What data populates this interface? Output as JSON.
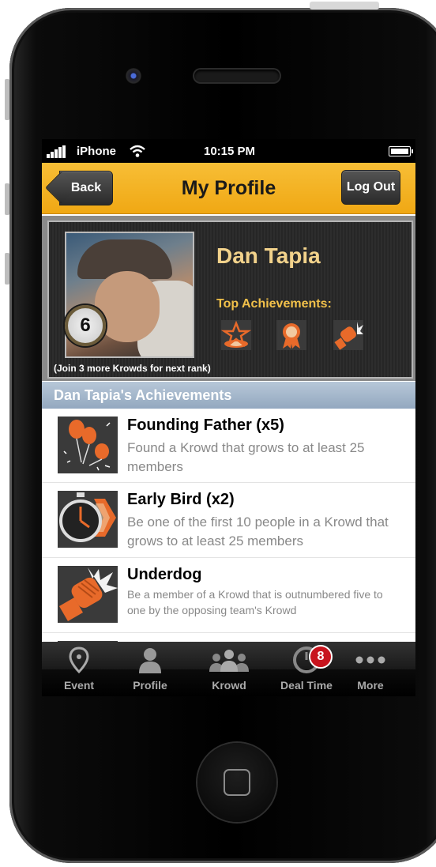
{
  "status_bar": {
    "carrier": "iPhone",
    "time": "10:15 PM"
  },
  "nav": {
    "back_label": "Back",
    "title": "My Profile",
    "logout_label": "Log Out"
  },
  "profile": {
    "name": "Dan Tapia",
    "rank": "6",
    "rank_note": "(Join 3 more Krowds for next rank)",
    "top_achievements_label": "Top Achievements:",
    "top_achievement_icons": [
      "star-target-icon",
      "ribbon-medal-icon",
      "fist-burst-icon"
    ]
  },
  "achievements": {
    "header": "Dan Tapia's Achievements",
    "items": [
      {
        "title": "Founding Father (x5)",
        "desc": "Found a Krowd that grows to at least 25 members",
        "icon": "balloons-icon"
      },
      {
        "title": "Early Bird (x2)",
        "desc": "Be one of the first 10 people in a Krowd that grows to at least 25 members",
        "icon": "stopwatch-icon"
      },
      {
        "title": "Underdog",
        "desc": "Be a member of a Krowd that is outnumbered five to one by the opposing team's Krowd",
        "icon": "fist-icon"
      }
    ]
  },
  "tabs": [
    {
      "label": "Event",
      "icon": "map-pin-icon"
    },
    {
      "label": "Profile",
      "icon": "person-icon"
    },
    {
      "label": "Krowd",
      "icon": "group-icon"
    },
    {
      "label": "Deal Time",
      "icon": "timer-icon",
      "badge": "8"
    },
    {
      "label": "More",
      "icon": "more-dots-icon"
    }
  ],
  "colors": {
    "nav_accent": "#f0a814",
    "title_name": "#f2d28b",
    "badge_red": "#c8141e",
    "section_header": "#a5b8cc"
  }
}
